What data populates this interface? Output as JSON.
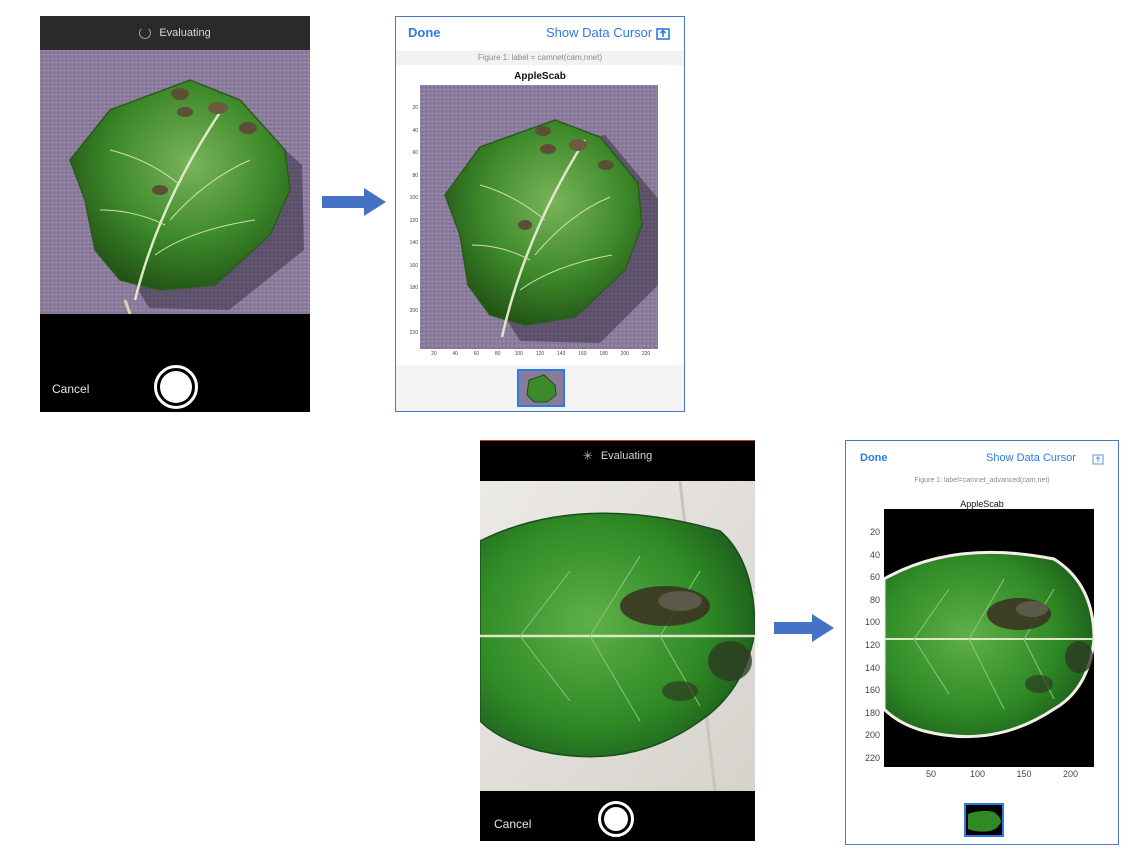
{
  "colors": {
    "accent": "#2c7be5",
    "arrow": "#4472c4",
    "leaf_dark": "#245a18",
    "leaf_mid": "#3e8a2a",
    "leaf_light": "#6cae4a",
    "lesion": "#5b5036",
    "purple_bg": "#8a7b9a",
    "light_bg": "#e7e4e0"
  },
  "top_example": {
    "camera": {
      "status_text": "Evaluating",
      "cancel_label": "Cancel",
      "icons": [
        "spinner-icon",
        "shutter-button"
      ]
    },
    "figure": {
      "done_label": "Done",
      "cursor_label": "Show Data Cursor",
      "figure_label": "Figure 1: label = camnet(cam,nnet)",
      "title": "AppleScab",
      "y_ticks": [
        "20",
        "40",
        "60",
        "80",
        "100",
        "120",
        "140",
        "160",
        "180",
        "200",
        "220"
      ],
      "x_ticks": [
        "20",
        "40",
        "60",
        "80",
        "100",
        "120",
        "140",
        "160",
        "180",
        "200",
        "220"
      ],
      "icons": [
        "share-icon"
      ]
    }
  },
  "bottom_example": {
    "camera": {
      "status_text": "Evaluating",
      "cancel_label": "Cancel",
      "icons": [
        "activity-spinner-icon",
        "shutter-button"
      ]
    },
    "figure": {
      "done_label": "Done",
      "cursor_label": "Show Data Cursor",
      "figure_label": "Figure 1: label=camnet_advanced(cam,net)",
      "title": "AppleScab",
      "y_ticks": [
        "20",
        "40",
        "60",
        "80",
        "100",
        "120",
        "140",
        "160",
        "180",
        "200",
        "220"
      ],
      "x_ticks": [
        "50",
        "100",
        "150",
        "200"
      ],
      "icons": [
        "share-icon"
      ]
    }
  }
}
